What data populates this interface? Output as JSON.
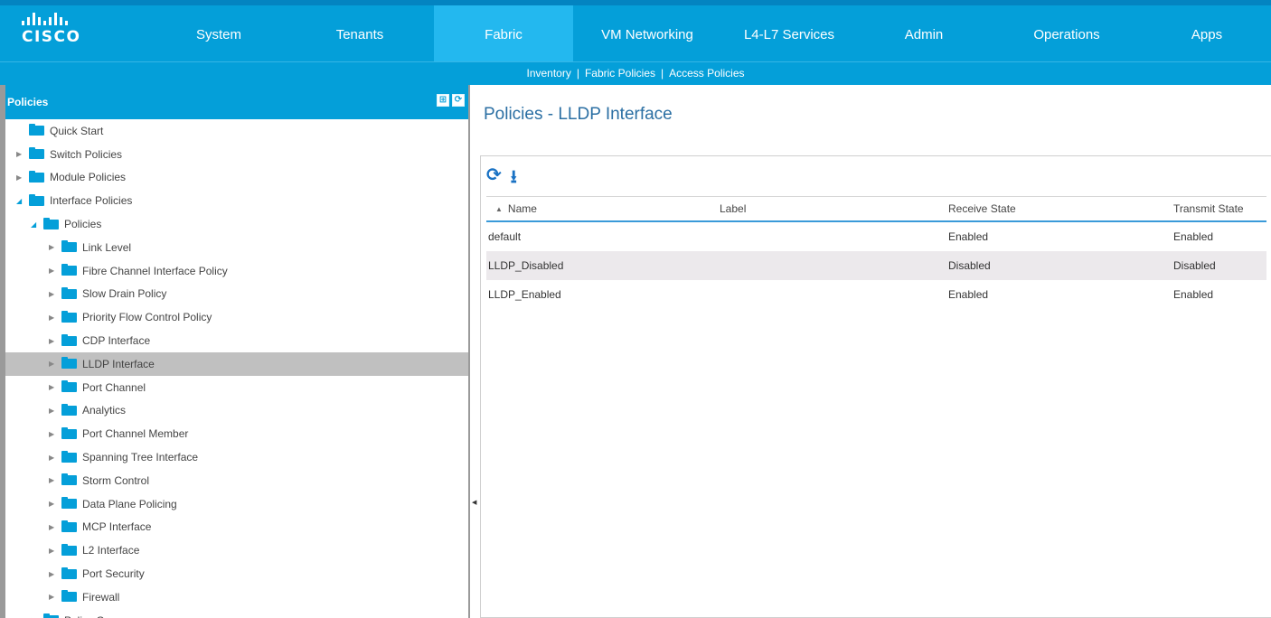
{
  "brand": {
    "logo_text": "CISCO",
    "accent": "#049fd9",
    "active_tab_color": "#23b8ef"
  },
  "nav": {
    "tabs": [
      {
        "label": "System"
      },
      {
        "label": "Tenants"
      },
      {
        "label": "Fabric"
      },
      {
        "label": "VM Networking"
      },
      {
        "label": "L4-L7 Services"
      },
      {
        "label": "Admin"
      },
      {
        "label": "Operations"
      },
      {
        "label": "Apps"
      }
    ],
    "active": "Fabric"
  },
  "subnav": {
    "items": [
      "Inventory",
      "Fabric Policies",
      "Access Policies"
    ],
    "separator": "|"
  },
  "left_panel": {
    "title": "Policies",
    "tree": [
      {
        "label": "Quick Start",
        "level": 0,
        "caret": ""
      },
      {
        "label": "Switch Policies",
        "level": 0,
        "caret": "closed"
      },
      {
        "label": "Module Policies",
        "level": 0,
        "caret": "closed"
      },
      {
        "label": "Interface Policies",
        "level": 0,
        "caret": "open"
      },
      {
        "label": "Policies",
        "level": 1,
        "caret": "open"
      },
      {
        "label": "Link Level",
        "level": 2,
        "caret": "closed"
      },
      {
        "label": "Fibre Channel Interface Policy",
        "level": 2,
        "caret": "closed"
      },
      {
        "label": "Slow Drain Policy",
        "level": 2,
        "caret": "closed"
      },
      {
        "label": "Priority Flow Control Policy",
        "level": 2,
        "caret": "closed"
      },
      {
        "label": "CDP Interface",
        "level": 2,
        "caret": "closed"
      },
      {
        "label": "LLDP Interface",
        "level": 2,
        "caret": "closed",
        "selected": true
      },
      {
        "label": "Port Channel",
        "level": 2,
        "caret": "closed"
      },
      {
        "label": "Analytics",
        "level": 2,
        "caret": "closed"
      },
      {
        "label": "Port Channel Member",
        "level": 2,
        "caret": "closed"
      },
      {
        "label": "Spanning Tree Interface",
        "level": 2,
        "caret": "closed"
      },
      {
        "label": "Storm Control",
        "level": 2,
        "caret": "closed"
      },
      {
        "label": "Data Plane Policing",
        "level": 2,
        "caret": "closed"
      },
      {
        "label": "MCP Interface",
        "level": 2,
        "caret": "closed"
      },
      {
        "label": "L2 Interface",
        "level": 2,
        "caret": "closed"
      },
      {
        "label": "Port Security",
        "level": 2,
        "caret": "closed"
      },
      {
        "label": "Firewall",
        "level": 2,
        "caret": "closed"
      },
      {
        "label": "Policy Groups",
        "level": 1,
        "caret": "closed"
      }
    ]
  },
  "main": {
    "title": "Policies - LLDP Interface",
    "columns": [
      "Name",
      "Label",
      "Receive State",
      "Transmit State"
    ],
    "rows": [
      {
        "name": "default",
        "label": "",
        "receive": "Enabled",
        "transmit": "Enabled"
      },
      {
        "name": "LLDP_Disabled",
        "label": "",
        "receive": "Disabled",
        "transmit": "Disabled"
      },
      {
        "name": "LLDP_Enabled",
        "label": "",
        "receive": "Enabled",
        "transmit": "Enabled"
      }
    ]
  }
}
